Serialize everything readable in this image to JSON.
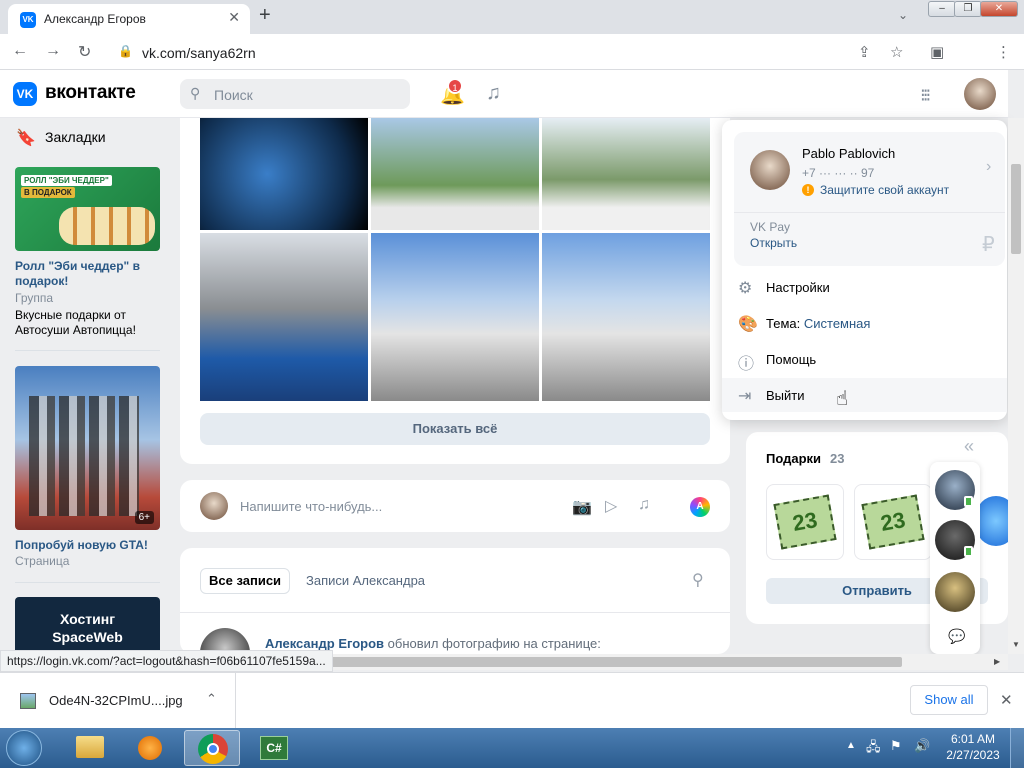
{
  "browser": {
    "tab_title": "Александр Егоров",
    "tab_favicon": "VK",
    "url": "vk.com/sanya62rn",
    "status_url": "https://login.vk.com/?act=logout&hash=f06b61107fe5159a..."
  },
  "header": {
    "brand": "вконтакте",
    "logo": "VK",
    "search_placeholder": "Поиск",
    "notif_count": "1"
  },
  "left": {
    "bookmarks": "Закладки",
    "ads": [
      {
        "image_text_1": "РОЛЛ \"ЭБИ ЧЕДДЕР\"",
        "image_text_2": "В ПОДАРОК",
        "title": "Ролл \"Эби чеддер\" в подарок!",
        "type": "Группа",
        "desc": "Вкусные подарки от Автосуши Автопицца!"
      },
      {
        "badge": "6+",
        "title": "Попробуй новую GTA!",
        "type": "Страница"
      },
      {
        "image_text_1": "Хостинг",
        "image_text_2": "SpaceWeb"
      }
    ]
  },
  "center": {
    "show_all": "Показать всё",
    "compose_placeholder": "Напишите что-нибудь...",
    "compose_letter": "A",
    "tabs": {
      "all": "Все записи",
      "his": "Записи Александра"
    },
    "post": {
      "author": "Александр Егоров",
      "action": "обновил фотографию на странице:"
    }
  },
  "dropdown": {
    "name": "Pablo Pablovich",
    "phone": "+7 ··· ··· ·· 97",
    "protect": "Защитите свой аккаунт",
    "vkpay": "VK Pay",
    "open": "Открыть",
    "currency": "₽",
    "settings": "Настройки",
    "theme_label": "Тема:",
    "theme_value": "Системная",
    "help": "Помощь",
    "logout": "Выйти"
  },
  "gifts": {
    "title": "Подарки",
    "count": "23",
    "gift_label": "23",
    "send": "Отправить"
  },
  "download": {
    "file": "Ode4N-32CPImU....jpg",
    "show_all": "Show all"
  },
  "taskbar": {
    "time": "6:01 AM",
    "date": "2/27/2023",
    "csharp": "C#"
  },
  "colors": {
    "vk_blue": "#0077ff",
    "link": "#2a5885",
    "bg": "#edeef0",
    "danger": "#e64646"
  }
}
